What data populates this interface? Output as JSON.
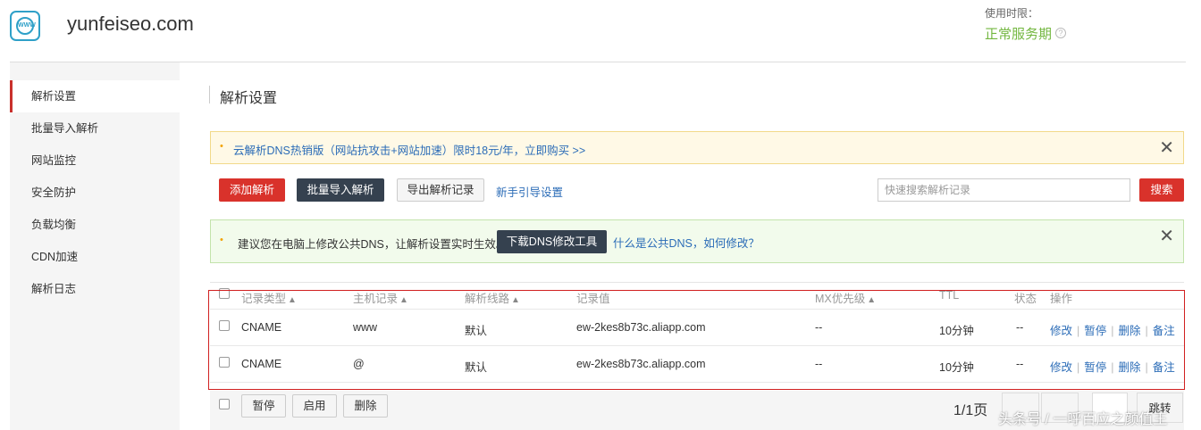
{
  "header": {
    "logo_text": "WWW",
    "domain": "yunfeiseo.com",
    "usage_label": "使用时限：",
    "usage_status": "正常服务期",
    "help_glyph": "?"
  },
  "sidebar": {
    "items": [
      {
        "label": "解析设置",
        "active": true
      },
      {
        "label": "批量导入解析"
      },
      {
        "label": "网站监控"
      },
      {
        "label": "安全防护"
      },
      {
        "label": "负载均衡"
      },
      {
        "label": "CDN加速"
      },
      {
        "label": "解析日志"
      }
    ]
  },
  "main": {
    "title": "解析设置",
    "notice": {
      "bullet": "•",
      "text": "云解析DNS热销版（网站抗攻击+网站加速）限时18元/年，立即购买 >>",
      "close": "✕"
    },
    "toolbar": {
      "add": "添加解析",
      "batch_import": "批量导入解析",
      "export": "导出解析记录",
      "guide": "新手引导设置",
      "search_placeholder": "快速搜索解析记录",
      "search": "搜索"
    },
    "tip": {
      "bullet": "•",
      "text": "建议您在电脑上修改公共DNS，让解析设置实时生效。",
      "download": "下载DNS修改工具",
      "link": "什么是公共DNS，如何修改？",
      "close": "✕"
    },
    "table": {
      "columns": [
        "记录类型",
        "主机记录",
        "解析线路",
        "记录值",
        "MX优先级",
        "TTL",
        "状态",
        "操作"
      ],
      "sort_arrow": "▲",
      "rows": [
        {
          "type": "CNAME",
          "host": "www",
          "line": "默认",
          "value": "ew-2kes8b73c.aliapp.com",
          "mx": "--",
          "ttl": "10分钟",
          "status": "--"
        },
        {
          "type": "CNAME",
          "host": "@",
          "line": "默认",
          "value": "ew-2kes8b73c.aliapp.com",
          "mx": "--",
          "ttl": "10分钟",
          "status": "--"
        }
      ],
      "actions": {
        "edit": "修改",
        "pause": "暂停",
        "delete": "删除",
        "note": "备注"
      },
      "sep": "|"
    },
    "footer": {
      "pause": "暂停",
      "enable": "启用",
      "delete": "删除",
      "page": "1/1页",
      "jump": "跳转"
    },
    "watermark": "头条号 / 一呼百应之颜值王"
  },
  "colors": {
    "accent_red": "#d9322b",
    "dark_button": "#35414f",
    "link_blue": "#2b6cb7",
    "status_green": "#73b740"
  }
}
